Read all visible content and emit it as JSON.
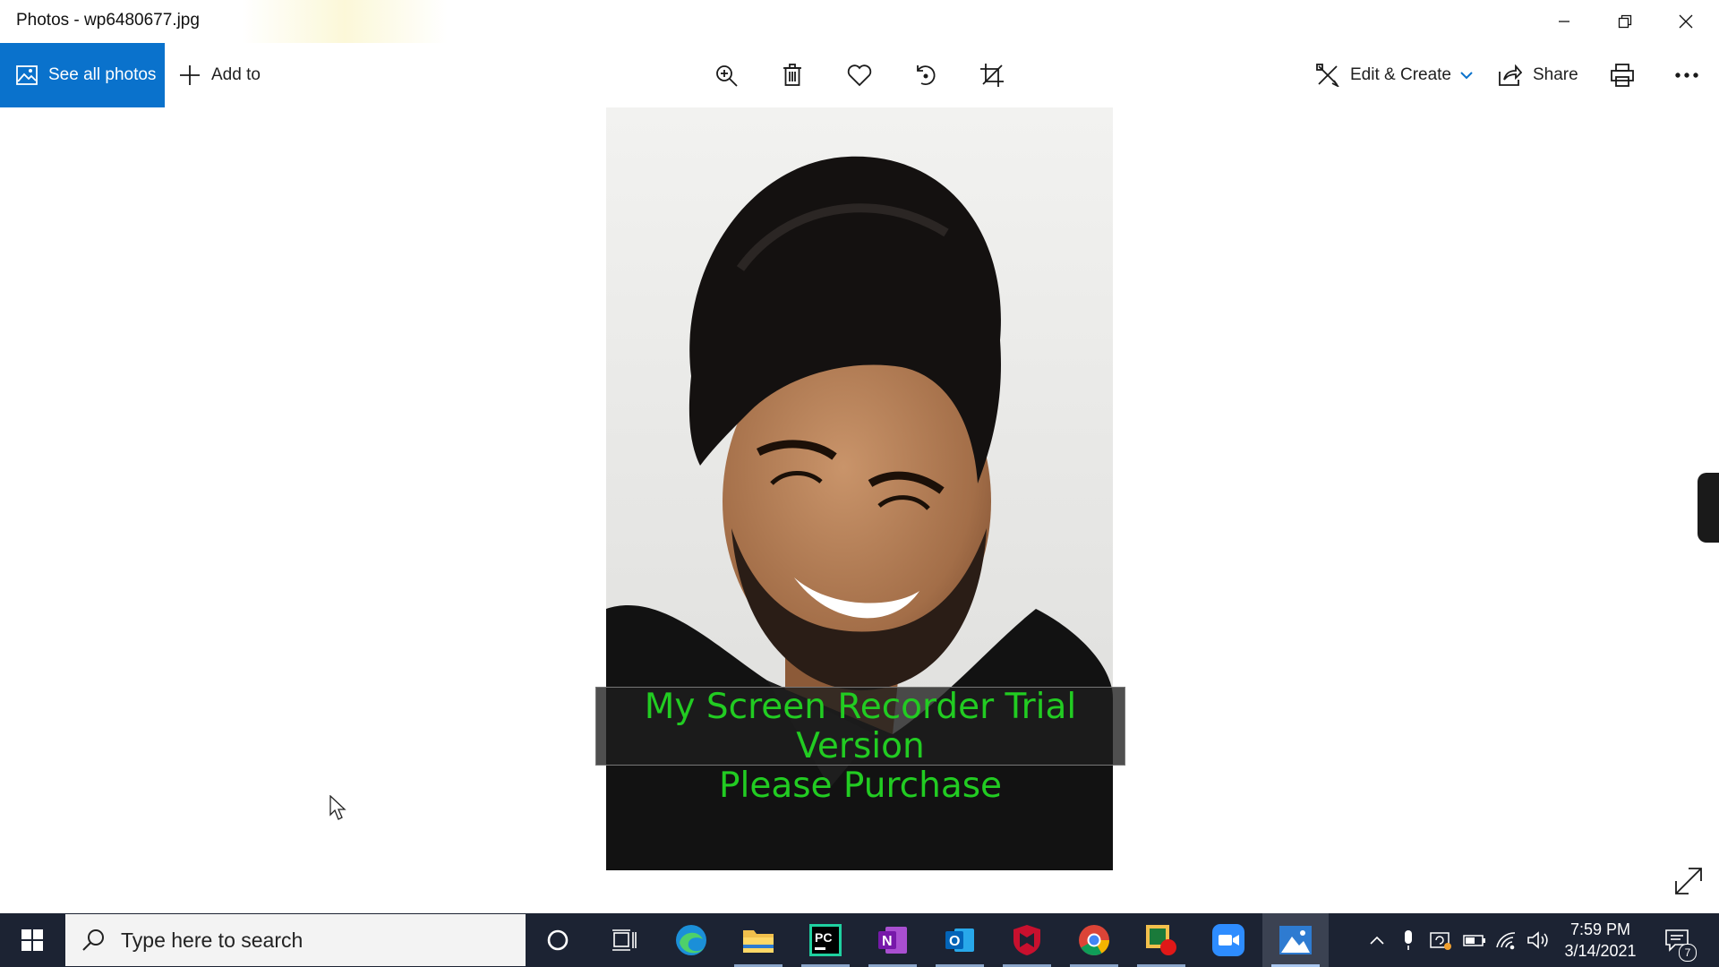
{
  "window": {
    "title": "Photos - wp6480677.jpg",
    "controls": [
      "minimize-icon",
      "restore-icon",
      "close-icon"
    ]
  },
  "toolbar": {
    "see_all_label": "See all photos",
    "add_to_label": "Add to",
    "center_tools": [
      "zoom-in-icon",
      "delete-icon",
      "favorite-heart-icon",
      "rotate-icon",
      "crop-icon"
    ],
    "edit_create_label": "Edit & Create",
    "share_label": "Share",
    "right_tools": [
      "print-icon",
      "more-options-icon"
    ],
    "accent_color": "#0a72cc"
  },
  "photo": {
    "watermark_line1": "My Screen Recorder Trial Version",
    "watermark_line2": "Please Purchase",
    "watermark_color": "#22cc22"
  },
  "taskbar": {
    "search_placeholder": "Type here to search",
    "apps": [
      "cortana-icon",
      "task-view-icon",
      "edge-icon",
      "file-explorer-icon",
      "pycharm-icon",
      "onenote-icon",
      "outlook-icon",
      "mcafee-icon",
      "chrome-icon",
      "screen-recorder-icon",
      "zoom-icon",
      "photos-icon"
    ],
    "pycharm_label": "PC",
    "onenote_label": "N",
    "outlook_label": "O",
    "clock_time": "7:59 PM",
    "clock_date": "3/14/2021",
    "notification_count": "7"
  }
}
